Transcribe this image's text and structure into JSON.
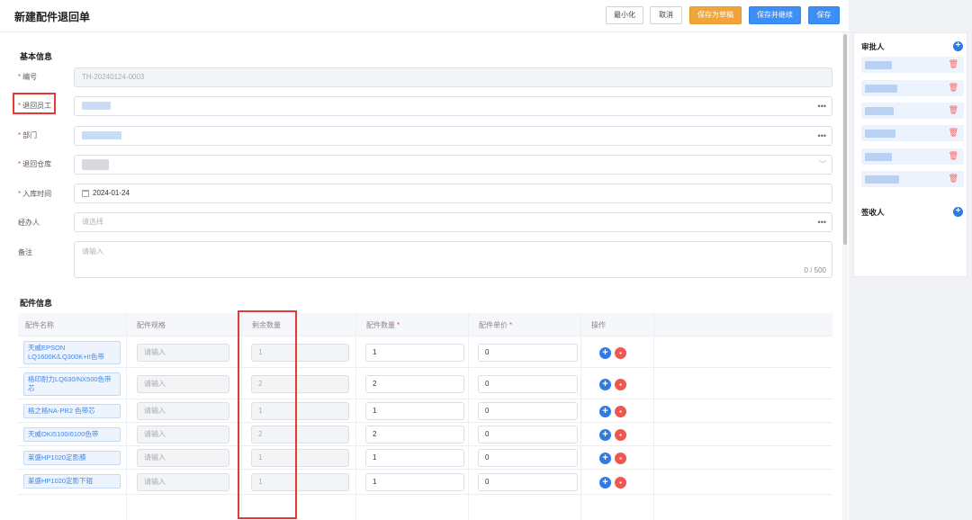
{
  "header": {
    "title": "新建配件退回单",
    "buttons": {
      "minimize": "最小化",
      "cancel": "取消",
      "save_draft": "保存为草稿",
      "save_continue": "保存并继续",
      "save": "保存"
    }
  },
  "basic_info": {
    "section_title": "基本信息",
    "fields": {
      "code": {
        "label": "编号",
        "value": "TH-20240124-0003"
      },
      "return_staff": {
        "label": "退回员工"
      },
      "department": {
        "label": "部门"
      },
      "return_warehouse": {
        "label": "退回仓库"
      },
      "inbound_time": {
        "label": "入库时间",
        "value": "2024-01-24"
      },
      "handler": {
        "label": "经办人",
        "placeholder": "请选择"
      },
      "remark": {
        "label": "备注",
        "placeholder": "请输入",
        "counter": "0 / 500"
      }
    }
  },
  "parts_info": {
    "section_title": "配件信息",
    "columns": [
      "配件名称",
      "配件规格",
      "剩余数量",
      "配件数量",
      "配件单价",
      "操作"
    ],
    "spec_placeholder": "请输入",
    "rows": [
      {
        "name": "天威EPSON LQ1600K/LQ300K+II色带",
        "remaining": "1",
        "qty": "1",
        "price": "0"
      },
      {
        "name": "格印耐力LQ630/NX500色带芯",
        "remaining": "2",
        "qty": "2",
        "price": "0"
      },
      {
        "name": "格之格NA-PR2 色带芯",
        "remaining": "1",
        "qty": "1",
        "price": "0"
      },
      {
        "name": "天威OKI5100/6100色带",
        "remaining": "2",
        "qty": "2",
        "price": "0"
      },
      {
        "name": "莱盛HP1020定影膜",
        "remaining": "1",
        "qty": "1",
        "price": "0"
      },
      {
        "name": "莱盛HP1020定影下辊",
        "remaining": "1",
        "qty": "1",
        "price": "0"
      }
    ]
  },
  "sidebar": {
    "approvers_title": "审批人",
    "receivers_title": "签收人"
  },
  "colors": {
    "primary": "#3d8ef5",
    "warning": "#f0a43a",
    "danger": "#f0554f",
    "highlight_box": "#e53935"
  }
}
